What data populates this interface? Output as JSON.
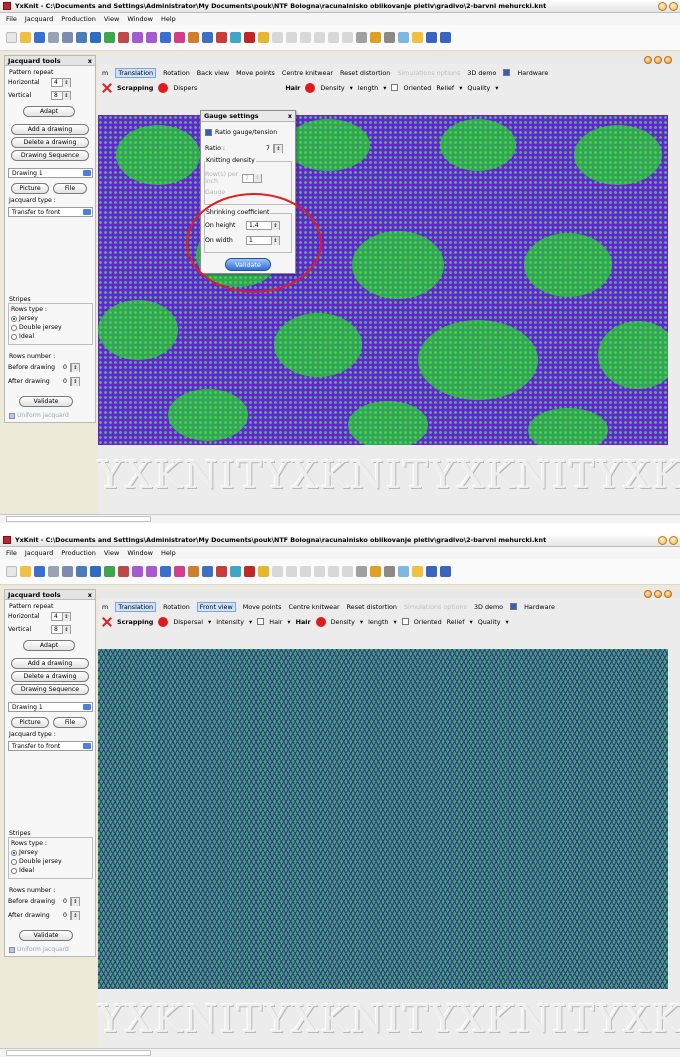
{
  "app": {
    "title": "YxKnit - C:\\Documents and Settings\\Administrator\\My Documents\\pouk\\NTF Bologna\\racunalnisko oblikovanje pletiv\\gradivo\\2-barvni mehurcki.knt"
  },
  "menu": [
    "File",
    "Jacquard",
    "Production",
    "View",
    "Window",
    "Help"
  ],
  "colors": {
    "fabric_purple": "#6a1fe0",
    "fabric_green": "#2db34b",
    "annotation_red": "#e01d1d",
    "accent_blue": "#2f6ed6"
  },
  "jacquard_tools": {
    "title": "Jacquard tools",
    "close": "x",
    "pattern_repeat": "Pattern repeat",
    "horizontal_label": "Horizontal",
    "horizontal_value": "4",
    "vertical_label": "Vertical",
    "vertical_value": "8",
    "adapt": "Adapt",
    "add_drawing": "Add a drawing",
    "delete_drawing": "Delete a drawing",
    "drawing_sequence": "Drawing Sequence",
    "drawing_select": "Drawing 1",
    "picture": "Picture",
    "file": "File",
    "jacquard_type_label": "Jacquard type :",
    "jacquard_type_value": "Transfer to front",
    "stripes": "Stripes",
    "rows_type": "Rows type :",
    "jersey": "Jersey",
    "double_jersey": "Double jersey",
    "ideal": "Ideal",
    "rows_number": "Rows number :",
    "before_drawing": "Before drawing",
    "before_value": "0",
    "after_drawing": "After drawing",
    "after_value": "0",
    "validate": "Validate",
    "uniform_jacquard": "Uniform jacquard"
  },
  "sim_tabs_1": {
    "m": "m",
    "translation": "Translation",
    "rotation": "Rotation",
    "view": "Back view",
    "move_points": "Move points",
    "centre_knitwear": "Centre knitwear",
    "reset_distortion": "Reset distortion",
    "simulations_options": "Simulations options",
    "demo_3d": "3D demo",
    "hardware": "Hardware"
  },
  "sim_tabs_2": {
    "m": "m",
    "translation": "Translation",
    "rotation": "Rotation",
    "view": "Front view",
    "move_points": "Move points",
    "centre_knitwear": "Centre knitwear",
    "reset_distortion": "Reset distortion",
    "simulations_options": "Simulations options",
    "demo_3d": "3D demo",
    "hardware": "Hardware"
  },
  "options_row": {
    "scrapping": "Scrapping",
    "dispersal": "Dispersal",
    "dispers_short": "Dispers",
    "intensity": "Intensity",
    "hair": "Hair",
    "hair_bold": "Hair",
    "density": "Density",
    "length": "length",
    "oriented": "Oriented",
    "relief": "Relief",
    "quality": "Quality",
    "arrow": "▾"
  },
  "gauge_dialog": {
    "title": "Gauge settings",
    "close": "x",
    "ratio_gauge_tension": "Ratio gauge/tension",
    "ratio_label": "Ratio :",
    "ratio_value": "7",
    "knitting_density": "Knitting density",
    "rows_per_inch": "Row(s) per inch",
    "rows_value": "7",
    "gauge": "Gauge",
    "shrinking": "Shrinking coefficient",
    "on_height": "On height",
    "on_height_value": "1,4",
    "on_width": "On width",
    "on_width_value": "1",
    "validate": "Validate"
  },
  "watermark": "YXKNIT"
}
